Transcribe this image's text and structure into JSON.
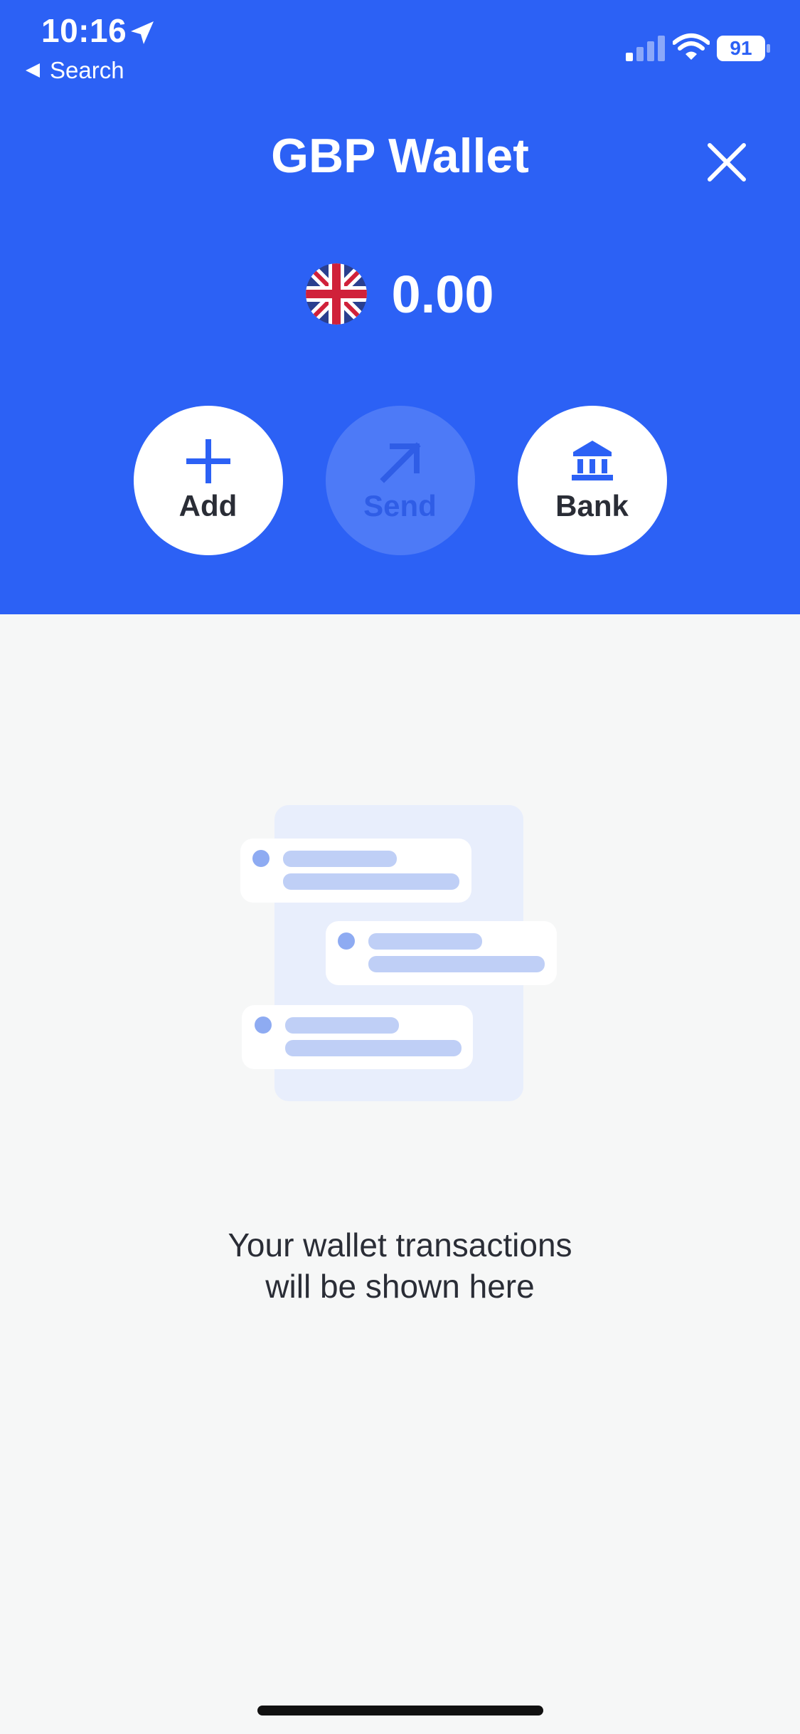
{
  "status_bar": {
    "time": "10:16",
    "back_label": "Search",
    "battery_level": "91"
  },
  "header": {
    "title": "GBP Wallet",
    "balance": "0.00",
    "flag": "uk-flag"
  },
  "actions": [
    {
      "label": "Add",
      "icon": "plus-icon",
      "enabled": true
    },
    {
      "label": "Send",
      "icon": "send-arrow-icon",
      "enabled": false
    },
    {
      "label": "Bank",
      "icon": "bank-icon",
      "enabled": true
    }
  ],
  "empty_state": {
    "line1": "Your wallet transactions",
    "line2": "will be shown here"
  },
  "colors": {
    "header_bg": "#2c61f5",
    "page_bg": "#f6f7f7",
    "text_dark": "#2a2d36"
  }
}
